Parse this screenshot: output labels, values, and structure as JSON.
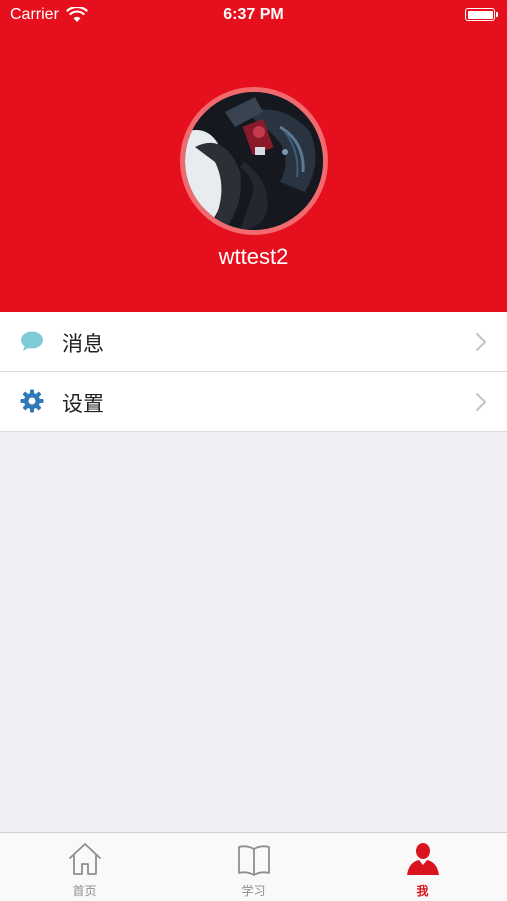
{
  "status_bar": {
    "carrier": "Carrier",
    "time": "6:37 PM"
  },
  "profile": {
    "username": "wttest2"
  },
  "menu": {
    "items": [
      {
        "label": "消息",
        "icon": "chat-bubble-icon",
        "icon_color": "#7ecbd6"
      },
      {
        "label": "设置",
        "icon": "gear-icon",
        "icon_color": "#2f79b8"
      }
    ]
  },
  "tab_bar": {
    "tabs": [
      {
        "label": "首页",
        "icon": "home-icon"
      },
      {
        "label": "学习",
        "icon": "book-icon"
      },
      {
        "label": "我",
        "icon": "person-icon",
        "active": true
      }
    ]
  },
  "colors": {
    "header_bg": "#e60f1e",
    "accent": "#d9141f",
    "page_bg": "#efeff4"
  }
}
